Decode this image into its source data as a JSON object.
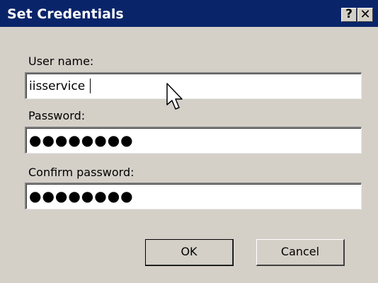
{
  "window": {
    "title": "Set Credentials",
    "help_label": "?",
    "close_label": "✕"
  },
  "form": {
    "user_name_label": "User name:",
    "user_name_value": "iisservice",
    "password_label": "Password:",
    "password_mask": "●●●●●●●●",
    "confirm_password_label": "Confirm password:",
    "confirm_password_mask": "●●●●●●●●"
  },
  "buttons": {
    "ok_label": "OK",
    "cancel_label": "Cancel"
  },
  "icons": {
    "cursor": "mouse-pointer-icon"
  },
  "colors": {
    "titlebar": "#0a246a",
    "dialog_face": "#d4d0c8"
  }
}
